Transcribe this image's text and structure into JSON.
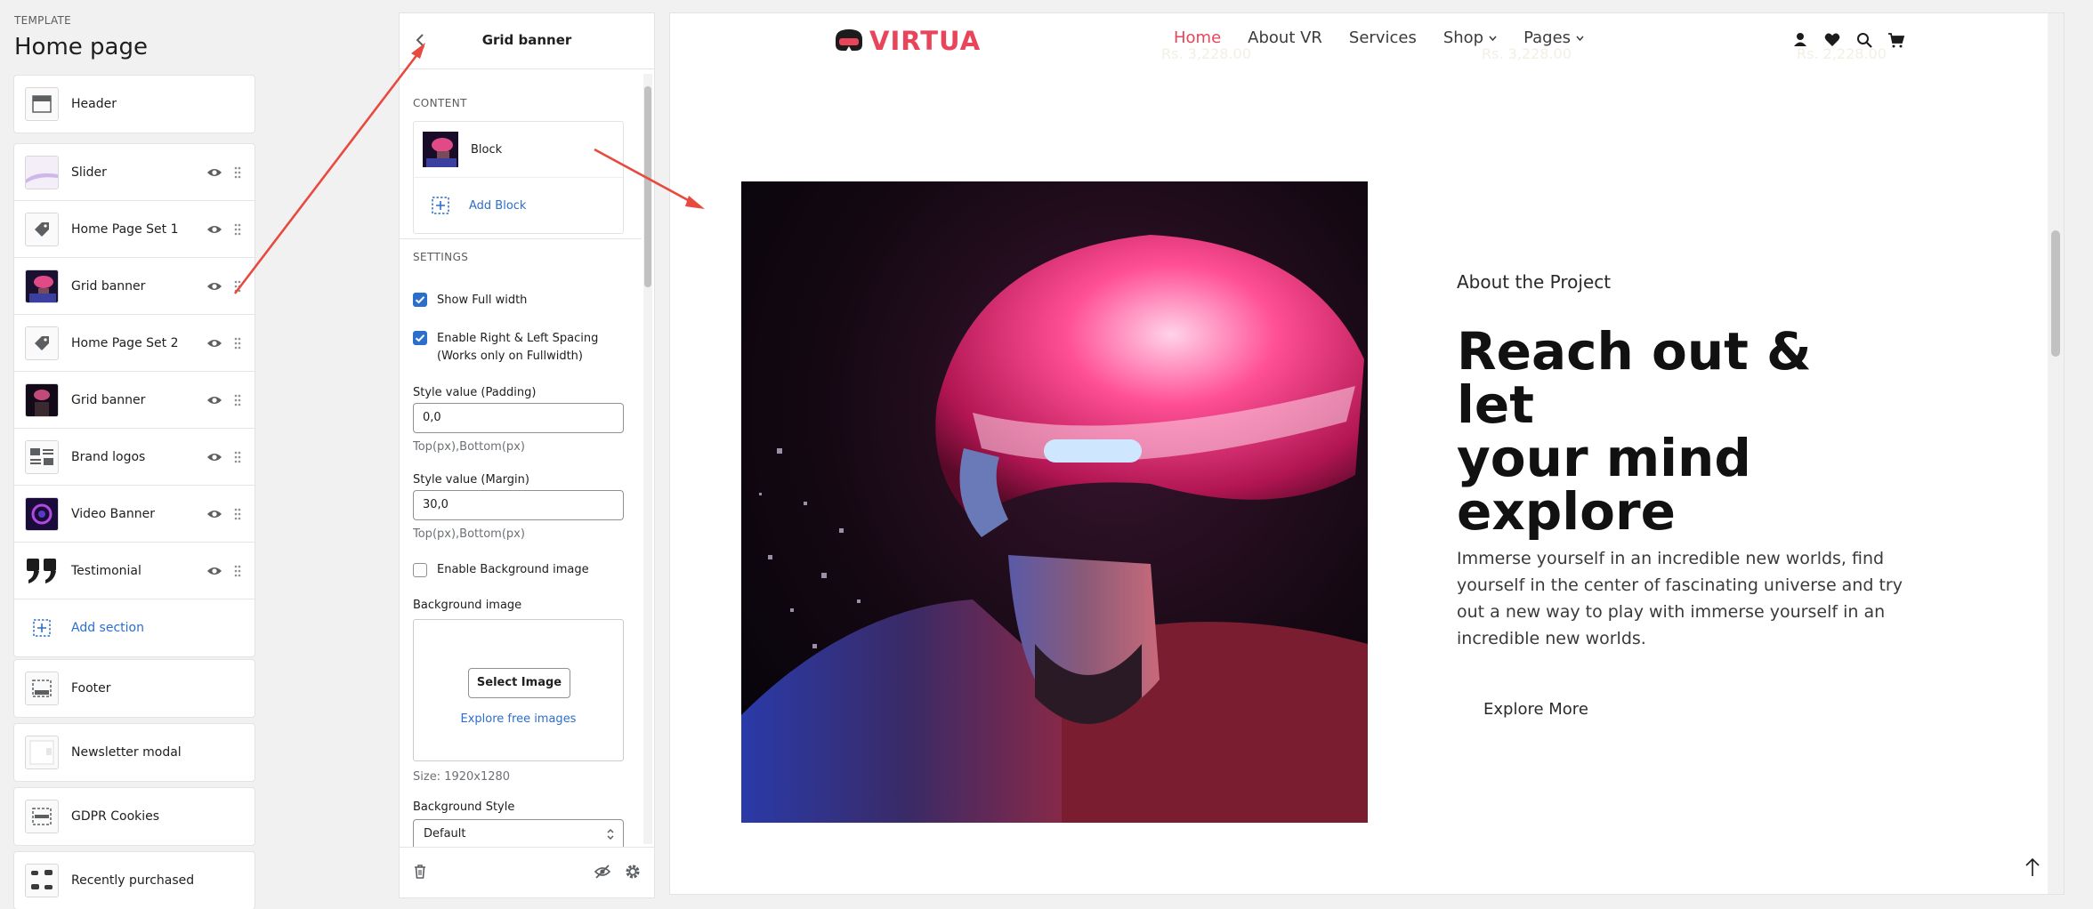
{
  "sidebar": {
    "caption": "TEMPLATE",
    "title": "Home page",
    "header_item": "Header",
    "items": [
      {
        "label": "Slider"
      },
      {
        "label": "Home Page Set 1"
      },
      {
        "label": "Grid banner"
      },
      {
        "label": "Home Page Set 2"
      },
      {
        "label": "Grid banner"
      },
      {
        "label": "Brand logos"
      },
      {
        "label": "Video Banner"
      },
      {
        "label": "Testimonial"
      }
    ],
    "add_section": "Add section",
    "footer_item": "Footer",
    "newsletter_item": "Newsletter modal",
    "gdpr_item": "GDPR Cookies",
    "recent_item": "Recently purchased"
  },
  "panel": {
    "title": "Grid banner",
    "content_label": "CONTENT",
    "block_label": "Block",
    "add_block": "Add Block",
    "settings_label": "SETTINGS",
    "show_full_width": "Show Full width",
    "enable_spacing_line1": "Enable Right & Left Spacing",
    "enable_spacing_line2": "(Works only on Fullwidth)",
    "padding_label": "Style value (Padding)",
    "padding_value": "0,0",
    "padding_hint": "Top(px),Bottom(px)",
    "margin_label": "Style value (Margin)",
    "margin_value": "30,0",
    "margin_hint": "Top(px),Bottom(px)",
    "enable_bg": "Enable Background image",
    "bg_label": "Background image",
    "select_image": "Select Image",
    "explore_images": "Explore free images",
    "size": "Size: 1920x1280",
    "bg_style_label": "Background Style",
    "bg_style_value": "Default"
  },
  "preview": {
    "logo_text": "VIRTUA",
    "menu": [
      "Home",
      "About VR",
      "Services",
      "Shop",
      "Pages"
    ],
    "about": "About the Project",
    "headline_line1": "Reach out & let",
    "headline_line2": "your mind",
    "headline_line3": "explore",
    "paragraph": "Immerse yourself in an incredible new worlds, find yourself in the center of fascinating universe and try out a new way to play with immerse yourself in an incredible new worlds.",
    "explore_more": "Explore More",
    "ghost_price_1": "Rs. 3,228.00",
    "ghost_price_2": "Rs. 3,228.00",
    "ghost_price_3": "Rs. 2,228.00"
  },
  "colors": {
    "accent": "#e8445a",
    "link": "#2c6ecb",
    "annotation_arrow": "#e84a3f"
  }
}
